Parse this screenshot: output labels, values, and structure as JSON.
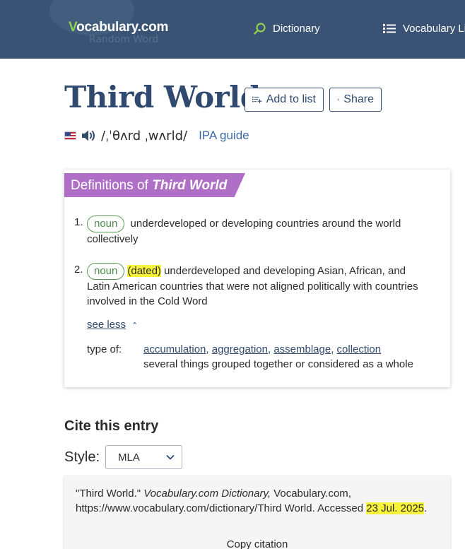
{
  "header": {
    "logo_text": "ocabulary.com",
    "logo_mark": "V",
    "ghost_text": "Random Word",
    "nav_dictionary": "Dictionary",
    "nav_vocab_lists": "Vocabulary Lis",
    "icons": {
      "dictionary": "search-icon",
      "lists": "list-icon"
    }
  },
  "entry": {
    "word": "Third World",
    "add_to_list_label": "Add to list",
    "share_label": "Share",
    "ipa": "/ˌˈθʌrd ˌwʌrld/",
    "ipa_guide_label": "IPA guide"
  },
  "definitions": {
    "banner_prefix": "Definitions of ",
    "banner_word": "Third World",
    "items": [
      {
        "num": "1.",
        "pos": "noun",
        "text": "underdeveloped or developing countries around the world collectively"
      },
      {
        "num": "2.",
        "pos": "noun",
        "label": "(dated)",
        "text": "underdeveloped and developing Asian, African, and Latin American countries that were not aligned politically with countries involved in the Cold Word"
      }
    ],
    "see_less_label": "see less",
    "type_of_label": "type of:",
    "type_of_links": [
      "accumulation",
      "aggregation",
      "assemblage",
      "collection"
    ],
    "type_of_sep": ", ",
    "type_of_def": "several things grouped together or considered as a whole"
  },
  "cite": {
    "title": "Cite this entry",
    "style_label": "Style:",
    "style_value": "MLA",
    "citation_part1": "\"Third World.\" ",
    "citation_italic": "Vocabulary.com Dictionary,",
    "citation_part2": " Vocabulary.com, https://www.vocabulary.com/dictionary/Third World. Accessed ",
    "citation_date": "23 Jul. 2025",
    "citation_end": ".",
    "copy_label": "Copy citation"
  },
  "colors": {
    "header_bg": "#3a5273",
    "title_navy": "#2f4a6e",
    "banner_purple": "#b06fc7",
    "pos_green": "#4d8a4d",
    "highlight": "#f7f33a",
    "logo_check": "#8fd14f"
  }
}
